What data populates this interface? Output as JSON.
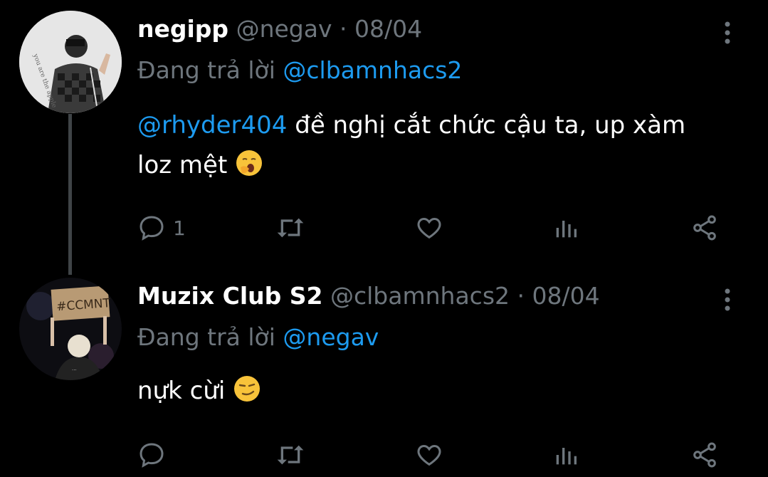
{
  "tweets": [
    {
      "name": "negipp",
      "handle": "@negav",
      "separator": "·",
      "date": "08/04",
      "reply_prefix": "Đang trả lời",
      "reply_to": "@clbamnhacs2",
      "body_mention": "@rhyder404",
      "body_text": " đề nghị cắt chức cậu ta, up xàm loz mệt ",
      "body_emoji": "yawning-face",
      "reply_count": "1",
      "avatar_text": "you are the apple of my eye"
    },
    {
      "name": "Muzix Club S2",
      "handle": "@clbamnhacs2",
      "separator": "·",
      "date": "08/04",
      "reply_prefix": "Đang trả lời",
      "reply_to": "@negav",
      "body_text": "nựk cừi ",
      "body_emoji": "smirking-face",
      "reply_count": "",
      "avatar_sign": "#CCMNT"
    }
  ],
  "colors": {
    "background": "#000000",
    "text_primary": "#ffffff",
    "text_secondary": "#6e767d",
    "mention": "#1d9bf0",
    "thread_line": "#3f4447"
  },
  "icons": [
    "reply-icon",
    "retweet-icon",
    "like-icon",
    "views-icon",
    "share-icon",
    "more-icon"
  ]
}
